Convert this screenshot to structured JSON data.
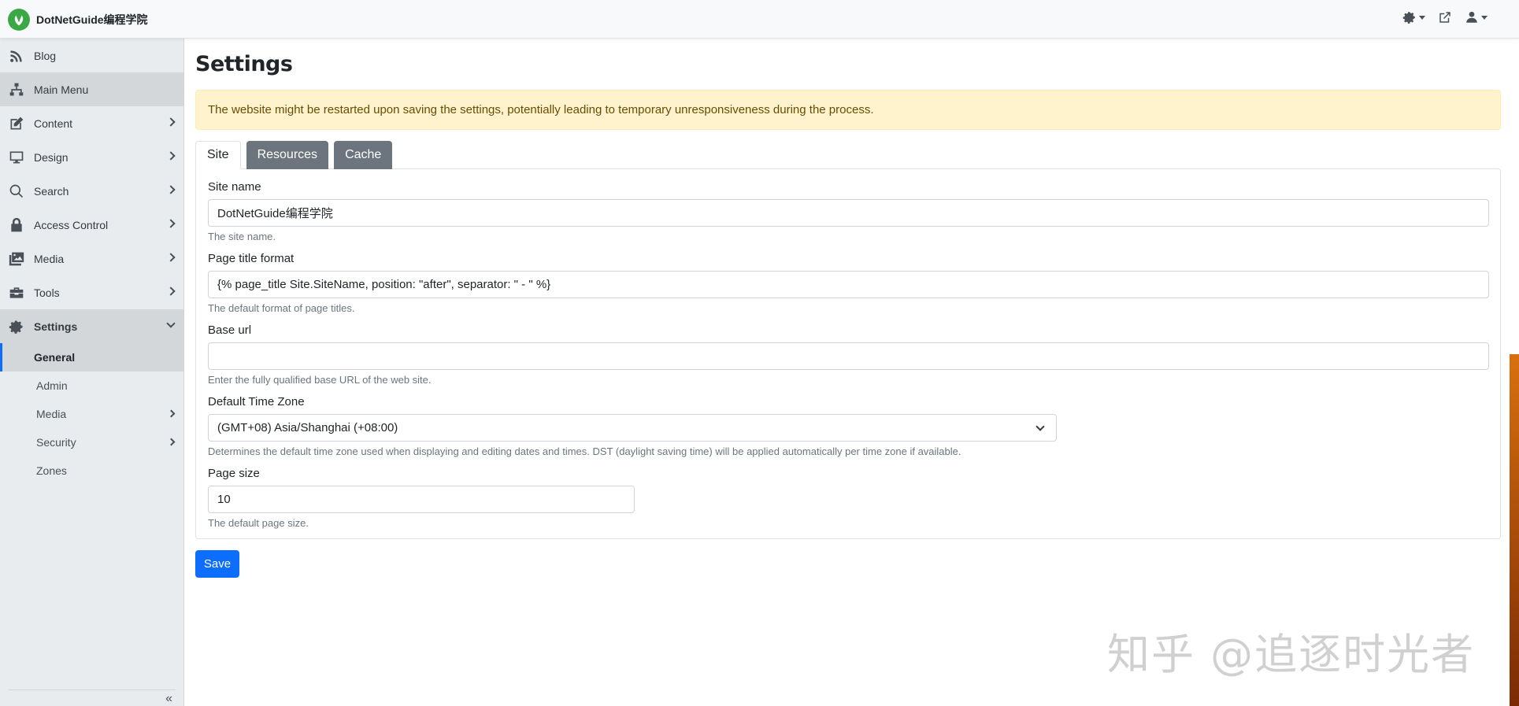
{
  "brand": {
    "name": "DotNetGuide编程学院"
  },
  "sidebar": {
    "items": [
      {
        "label": "Blog",
        "icon": "rss-icon"
      },
      {
        "label": "Main Menu",
        "icon": "sitemap-icon"
      },
      {
        "label": "Content",
        "icon": "edit-icon"
      },
      {
        "label": "Design",
        "icon": "monitor-icon"
      },
      {
        "label": "Search",
        "icon": "search-icon"
      },
      {
        "label": "Access Control",
        "icon": "lock-icon"
      },
      {
        "label": "Media",
        "icon": "images-icon"
      },
      {
        "label": "Tools",
        "icon": "toolbox-icon"
      },
      {
        "label": "Settings",
        "icon": "gear-icon"
      }
    ],
    "sub_items": [
      {
        "label": "General"
      },
      {
        "label": "Admin"
      },
      {
        "label": "Media"
      },
      {
        "label": "Security"
      },
      {
        "label": "Zones"
      }
    ],
    "collapse": "«"
  },
  "main": {
    "title": "Settings",
    "alert": "The website might be restarted upon saving the settings, potentially leading to temporary unresponsiveness during the process.",
    "tabs": [
      {
        "label": "Site"
      },
      {
        "label": "Resources"
      },
      {
        "label": "Cache"
      }
    ],
    "fields": {
      "site_name": {
        "label": "Site name",
        "value": "DotNetGuide编程学院",
        "help": "The site name."
      },
      "page_title_format": {
        "label": "Page title format",
        "value": "{% page_title Site.SiteName, position: \"after\", separator: \" - \" %}",
        "help": "The default format of page titles."
      },
      "base_url": {
        "label": "Base url",
        "value": "",
        "help": "Enter the fully qualified base URL of the web site."
      },
      "time_zone": {
        "label": "Default Time Zone",
        "value": "(GMT+08) Asia/Shanghai (+08:00)",
        "help": "Determines the default time zone used when displaying and editing dates and times. DST (daylight saving time) will be applied automatically per time zone if available."
      },
      "page_size": {
        "label": "Page size",
        "value": "10",
        "help": "The default page size."
      }
    },
    "save_label": "Save"
  },
  "watermark": "知乎 @追逐时光者",
  "colors": {
    "primary": "#0d6efd",
    "alert_bg": "#fff3cd",
    "tab_inactive": "#6c757d",
    "logo": "#3aa845"
  }
}
